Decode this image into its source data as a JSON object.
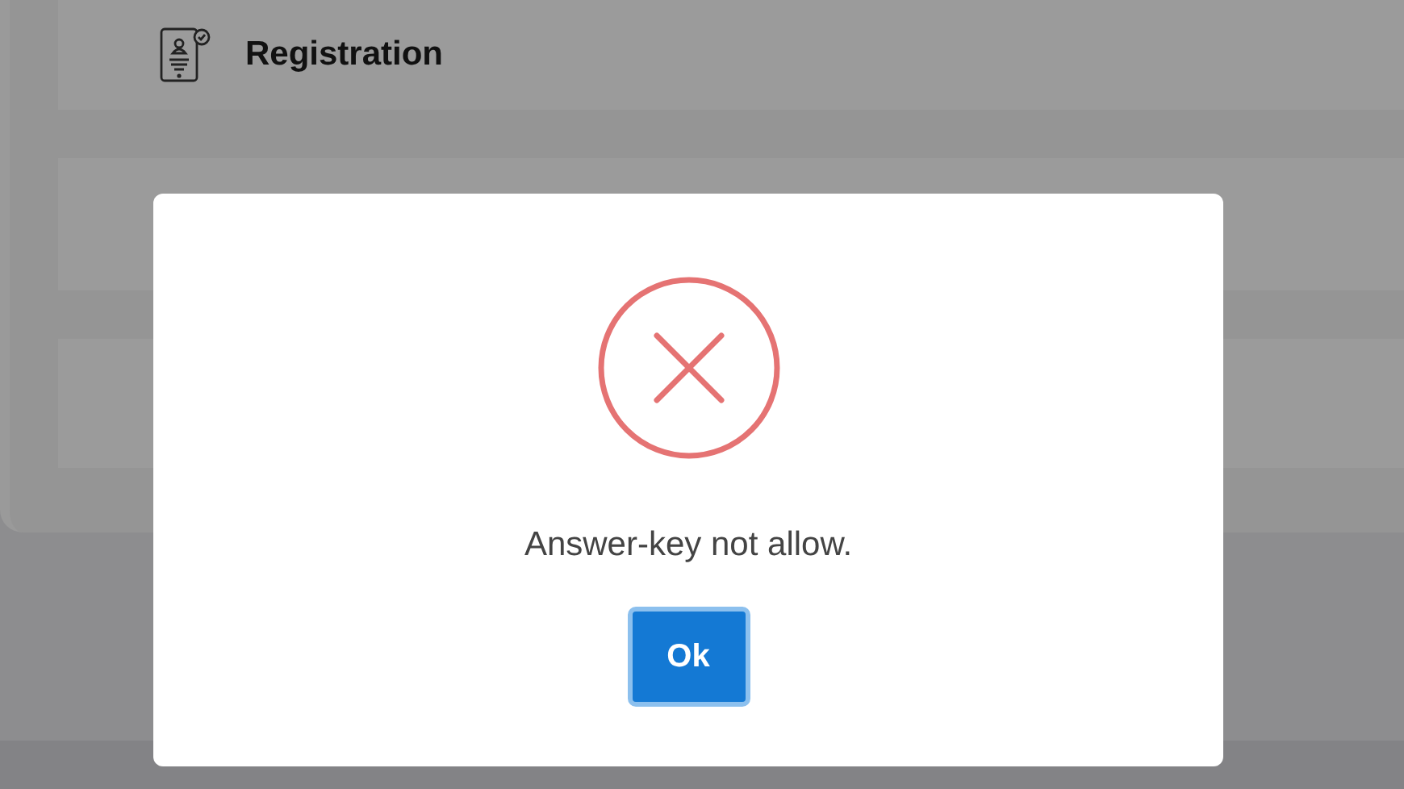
{
  "menu_items": [
    {
      "label": "Registration"
    }
  ],
  "dialog": {
    "kind": "error",
    "message": "Answer-key not allow.",
    "button": "Ok"
  }
}
